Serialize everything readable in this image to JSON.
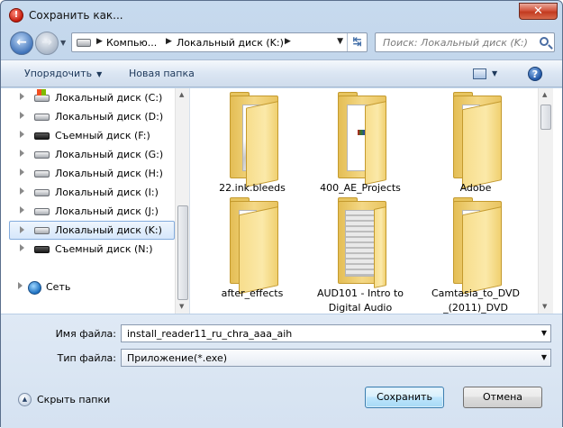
{
  "window": {
    "title": "Сохранить как..."
  },
  "address": {
    "crumbs": [
      "Компью...",
      "Локальный диск (K:)"
    ],
    "search_placeholder": "Поиск: Локальный диск (K:)"
  },
  "toolbar": {
    "organize_label": "Упорядочить",
    "new_folder_label": "Новая папка"
  },
  "sidebar": {
    "items": [
      {
        "label": "Локальный диск (C:)",
        "icon": "system-drive-icon"
      },
      {
        "label": "Локальный диск (D:)",
        "icon": "hard-drive-icon"
      },
      {
        "label": "Съемный диск (F:)",
        "icon": "removable-drive-icon"
      },
      {
        "label": "Локальный диск (G:)",
        "icon": "hard-drive-icon"
      },
      {
        "label": "Локальный диск (H:)",
        "icon": "hard-drive-icon"
      },
      {
        "label": "Локальный диск (I:)",
        "icon": "hard-drive-icon"
      },
      {
        "label": "Локальный диск (J:)",
        "icon": "hard-drive-icon"
      },
      {
        "label": "Локальный диск (K:)",
        "icon": "hard-drive-icon",
        "selected": true
      },
      {
        "label": "Съемный диск (N:)",
        "icon": "removable-drive-icon"
      },
      {
        "label": "Сеть",
        "icon": "network-icon"
      }
    ]
  },
  "files": [
    {
      "name": "22.ink.bleeds"
    },
    {
      "name": "400_AE_Projects"
    },
    {
      "name": "Adobe"
    },
    {
      "name": "after_effects"
    },
    {
      "name": "AUD101 - Intro to Digital Audio"
    },
    {
      "name": "Camtasia_to_DVD _(2011)_DVD"
    }
  ],
  "form": {
    "filename_label": "Имя файла:",
    "filename_value": "install_reader11_ru_chra_aaa_aih",
    "filetype_label": "Тип файла:",
    "filetype_value": "Приложение(*.exe)"
  },
  "footer": {
    "hide_folders_label": "Скрыть папки",
    "save_label": "Сохранить",
    "cancel_label": "Отмена"
  }
}
